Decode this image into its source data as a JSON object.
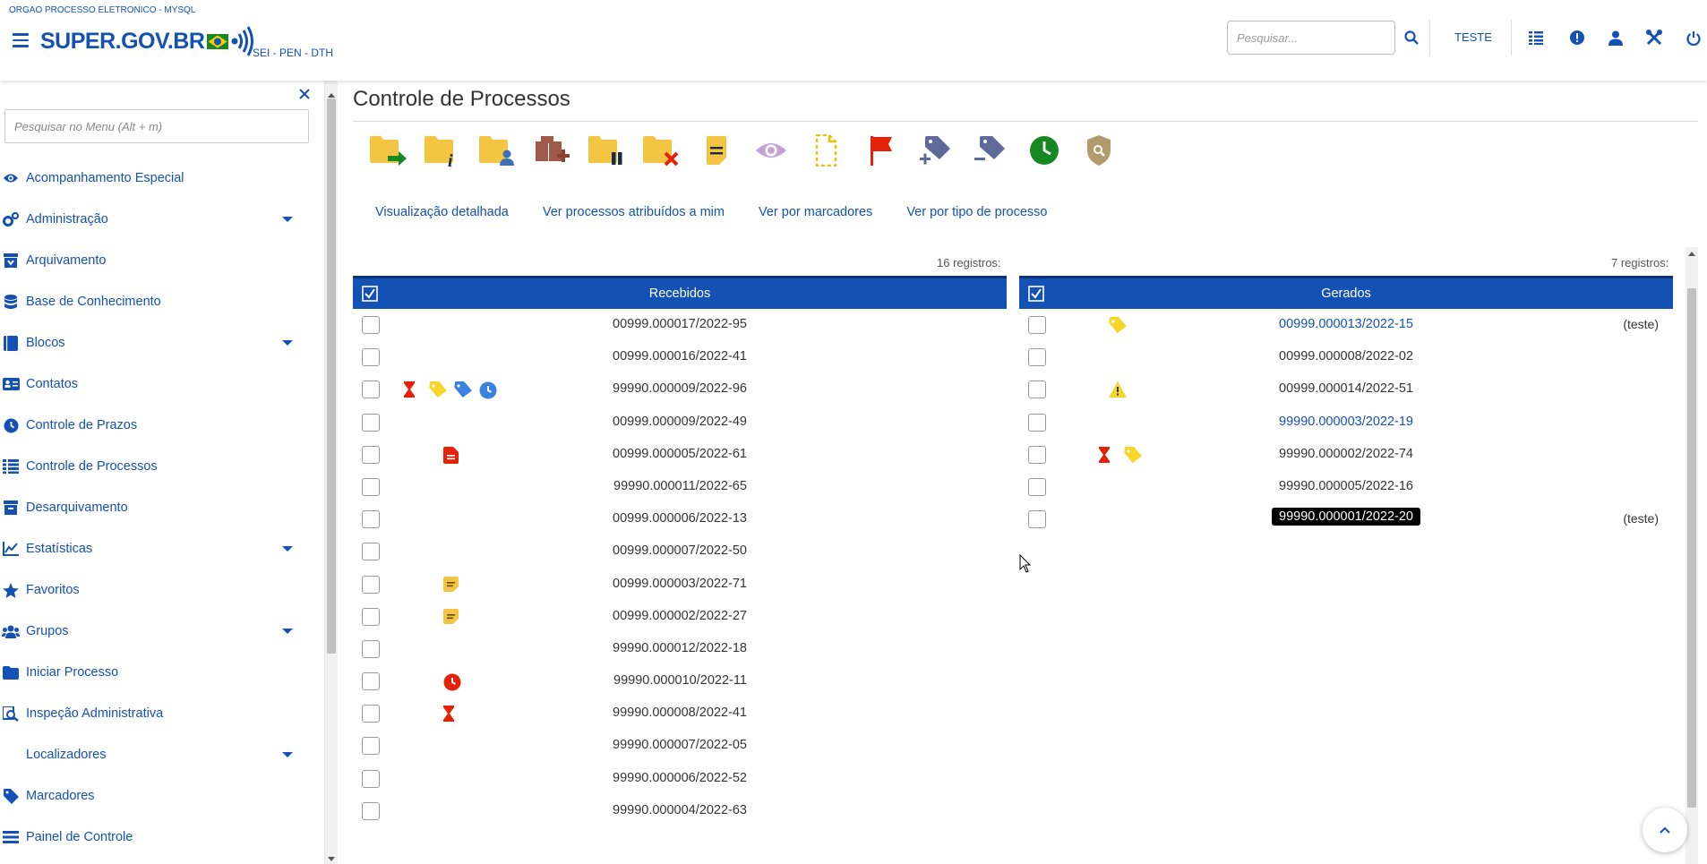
{
  "header": {
    "org_name": "ORGAO PROCESSO ELETRONICO - MYSQL",
    "logo_text": "SUPER.GOV.BR",
    "subtitle": "SEI - PEN - DTH",
    "search_placeholder": "Pesquisar...",
    "unit": "TESTE",
    "icons": [
      "hamburger-icon",
      "search-icon",
      "grid-icon",
      "alert-icon",
      "user-icon",
      "tools-icon",
      "power-icon"
    ]
  },
  "sidebar": {
    "search_placeholder": "Pesquisar no Menu (Alt + m)",
    "items": [
      {
        "label": "Acompanhamento Especial",
        "icon": "eye-icon",
        "has_submenu": false
      },
      {
        "label": "Administração",
        "icon": "gears-icon",
        "has_submenu": true
      },
      {
        "label": "Arquivamento",
        "icon": "archive-down-icon",
        "has_submenu": false
      },
      {
        "label": "Base de Conhecimento",
        "icon": "database-icon",
        "has_submenu": false
      },
      {
        "label": "Blocos",
        "icon": "book-icon",
        "has_submenu": true
      },
      {
        "label": "Contatos",
        "icon": "address-card-icon",
        "has_submenu": false
      },
      {
        "label": "Controle de Prazos",
        "icon": "clock-icon",
        "has_submenu": false
      },
      {
        "label": "Controle de Processos",
        "icon": "list-icon",
        "has_submenu": false
      },
      {
        "label": "Desarquivamento",
        "icon": "archive-up-icon",
        "has_submenu": false
      },
      {
        "label": "Estatísticas",
        "icon": "line-chart-icon",
        "has_submenu": true
      },
      {
        "label": "Favoritos",
        "icon": "star-icon",
        "has_submenu": false
      },
      {
        "label": "Grupos",
        "icon": "users-icon",
        "has_submenu": true
      },
      {
        "label": "Iniciar Processo",
        "icon": "folder-icon",
        "has_submenu": false
      },
      {
        "label": "Inspeção Administrativa",
        "icon": "inspect-icon",
        "has_submenu": false
      },
      {
        "label": "Localizadores",
        "icon": "",
        "has_submenu": true
      },
      {
        "label": "Marcadores",
        "icon": "tag-icon",
        "has_submenu": false
      },
      {
        "label": "Painel de Controle",
        "icon": "panel-icon",
        "has_submenu": false
      }
    ]
  },
  "main": {
    "title": "Controle de Processos",
    "toolbar": [
      "send-process-icon",
      "process-info-icon",
      "assign-process-icon",
      "new-block-icon",
      "pause-process-icon",
      "conclude-process-icon",
      "annotation-icon",
      "follow-icon",
      "new-document-icon",
      "flag-icon",
      "add-marker-icon",
      "remove-marker-icon",
      "deadline-icon",
      "restricted-icon"
    ],
    "views": [
      "Visualização detalhada",
      "Ver processos atribuídos a mim",
      "Ver por marcadores",
      "Ver por tipo de processo"
    ],
    "received": {
      "count_text": "16 registros:",
      "header": "Recebidos",
      "rows": [
        {
          "number": "00999.000017/2022-95",
          "icons": []
        },
        {
          "number": "00999.000016/2022-41",
          "icons": []
        },
        {
          "number": "99990.000009/2022-96",
          "icons": [
            "hourglass-icon",
            "tag-yellow-icon",
            "tag-blue-icon",
            "clock-blue-icon"
          ]
        },
        {
          "number": "00999.000009/2022-49",
          "icons": []
        },
        {
          "number": "00999.000005/2022-61",
          "icons": [
            "document-red-icon"
          ]
        },
        {
          "number": "99990.000011/2022-65",
          "icons": []
        },
        {
          "number": "00999.000006/2022-13",
          "icons": []
        },
        {
          "number": "00999.000007/2022-50",
          "icons": []
        },
        {
          "number": "00999.000003/2022-71",
          "icons": [
            "note-icon"
          ]
        },
        {
          "number": "00999.000002/2022-27",
          "icons": [
            "note-icon"
          ]
        },
        {
          "number": "99990.000012/2022-18",
          "icons": []
        },
        {
          "number": "99990.000010/2022-11",
          "icons": [
            "clock-red-icon"
          ]
        },
        {
          "number": "99990.000008/2022-41",
          "icons": [
            "hourglass-icon"
          ]
        },
        {
          "number": "99990.000007/2022-05",
          "icons": []
        },
        {
          "number": "99990.000006/2022-52",
          "icons": []
        },
        {
          "number": "99990.000004/2022-63",
          "icons": []
        }
      ]
    },
    "generated": {
      "count_text": "7 registros:",
      "header": "Gerados",
      "rows": [
        {
          "number": "00999.000013/2022-15",
          "icons": [
            "tag-yellow-icon"
          ],
          "note": "(teste)",
          "visited": true
        },
        {
          "number": "00999.000008/2022-02",
          "icons": [],
          "note": ""
        },
        {
          "number": "00999.000014/2022-51",
          "icons": [
            "warning-icon"
          ],
          "note": ""
        },
        {
          "number": "99990.000003/2022-19",
          "icons": [],
          "note": "",
          "visited": true
        },
        {
          "number": "99990.000002/2022-74",
          "icons": [
            "hourglass-icon",
            "tag-yellow-icon"
          ],
          "note": ""
        },
        {
          "number": "99990.000005/2022-16",
          "icons": [],
          "note": ""
        },
        {
          "number": "99990.000001/2022-20",
          "icons": [],
          "note": "(teste)",
          "highlight": true
        }
      ]
    }
  },
  "colors": {
    "primary": "#1351b4",
    "header_dark": "#0c326f",
    "folder": "#f4c542",
    "red": "#e52207",
    "green": "#168821"
  }
}
